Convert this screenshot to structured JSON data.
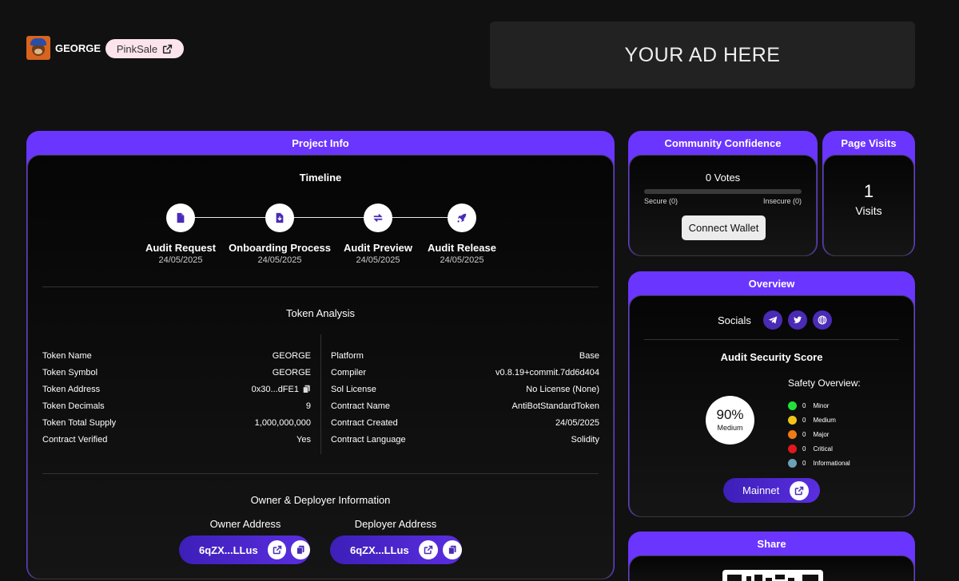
{
  "project": {
    "name": "GEORGE",
    "pinksale_label": "PinkSale"
  },
  "ad": {
    "text": "YOUR AD HERE"
  },
  "project_info": {
    "title": "Project Info",
    "timeline_title": "Timeline",
    "steps": [
      {
        "label": "Audit Request",
        "date": "24/05/2025",
        "icon": "document-icon"
      },
      {
        "label": "Onboarding Process",
        "date": "24/05/2025",
        "icon": "download-document-icon"
      },
      {
        "label": "Audit Preview",
        "date": "24/05/2025",
        "icon": "sync-arrows-icon"
      },
      {
        "label": "Audit Release",
        "date": "24/05/2025",
        "icon": "rocket-icon"
      }
    ],
    "token_analysis_title": "Token Analysis",
    "left_rows": [
      {
        "key": "Token Name",
        "value": "GEORGE"
      },
      {
        "key": "Token Symbol",
        "value": "GEORGE"
      },
      {
        "key": "Token Address",
        "value": "0x30...dFE1"
      },
      {
        "key": "Token Decimals",
        "value": "9"
      },
      {
        "key": "Token Total Supply",
        "value": "1,000,000,000"
      },
      {
        "key": "Contract Verified",
        "value": "Yes"
      }
    ],
    "right_rows": [
      {
        "key": "Platform",
        "value": "Base"
      },
      {
        "key": "Compiler",
        "value": "v0.8.19+commit.7dd6d404"
      },
      {
        "key": "Sol License",
        "value": "No License (None)"
      },
      {
        "key": "Contract Name",
        "value": "AntiBotStandardToken"
      },
      {
        "key": "Contract Created",
        "value": "24/05/2025"
      },
      {
        "key": "Contract Language",
        "value": "Solidity"
      }
    ],
    "owner_section_title": "Owner & Deployer Information",
    "owner_label": "Owner Address",
    "owner_value": "6qZX...LLus",
    "deployer_label": "Deployer Address",
    "deployer_value": "6qZX...LLus"
  },
  "community": {
    "title": "Community Confidence",
    "votes": "0 Votes",
    "secure": "Secure (0)",
    "insecure": "Insecure (0)",
    "connect_label": "Connect Wallet"
  },
  "page_visits": {
    "title": "Page Visits",
    "count": "1",
    "label": "Visits"
  },
  "overview": {
    "title": "Overview",
    "socials_label": "Socials",
    "score_title": "Audit Security Score",
    "score_pct": "90%",
    "score_level": "Medium",
    "safety_title": "Safety Overview:",
    "safety": [
      {
        "count": "0",
        "label": "Minor",
        "color": "#22e03a"
      },
      {
        "count": "0",
        "label": "Medium",
        "color": "#f0c419"
      },
      {
        "count": "0",
        "label": "Major",
        "color": "#f07a16"
      },
      {
        "count": "0",
        "label": "Critical",
        "color": "#e0181e"
      },
      {
        "count": "0",
        "label": "Informational",
        "color": "#6aa2b8"
      }
    ],
    "mainnet_label": "Mainnet"
  },
  "share": {
    "title": "Share"
  },
  "colors": {
    "accent": "#6a35ff",
    "pill": "#4a2bb5"
  }
}
